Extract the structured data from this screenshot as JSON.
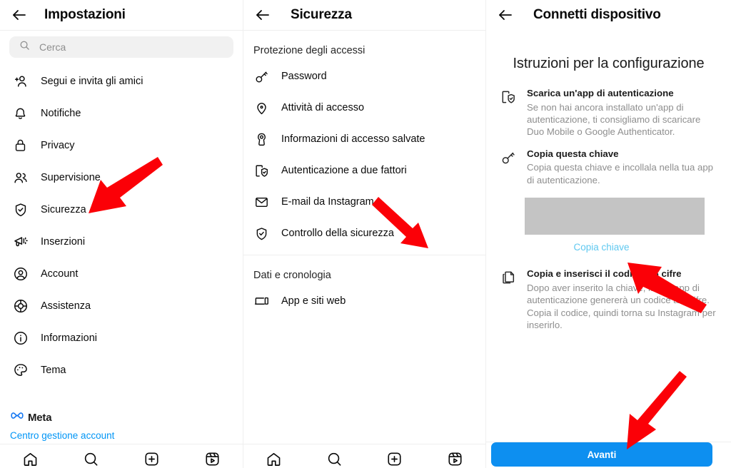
{
  "colors": {
    "accent_blue": "#0d8ff0",
    "link_blue": "#0095f6",
    "copy_link_blue": "#5fc8f0",
    "arrow_red": "#fb0007",
    "text_primary": "#0a0a0a",
    "text_secondary": "#8e8e8e",
    "search_bg": "#f1f1f1",
    "key_box_gray": "#c4c4c4",
    "divider": "#efefef"
  },
  "panel_settings": {
    "header": {
      "title": "Impostazioni",
      "back_icon": "back-arrow-icon"
    },
    "search": {
      "placeholder": "Cerca",
      "icon": "search-icon"
    },
    "items": [
      {
        "label": "Segui e invita gli amici",
        "icon": "add-person-icon"
      },
      {
        "label": "Notifiche",
        "icon": "bell-icon"
      },
      {
        "label": "Privacy",
        "icon": "lock-icon"
      },
      {
        "label": "Supervisione",
        "icon": "people-icon"
      },
      {
        "label": "Sicurezza",
        "icon": "shield-check-icon"
      },
      {
        "label": "Inserzioni",
        "icon": "megaphone-icon"
      },
      {
        "label": "Account",
        "icon": "account-circle-icon"
      },
      {
        "label": "Assistenza",
        "icon": "lifebuoy-icon"
      },
      {
        "label": "Informazioni",
        "icon": "info-circle-icon"
      },
      {
        "label": "Tema",
        "icon": "palette-icon"
      }
    ],
    "footer": {
      "meta_logo_icon": "meta-infinity-icon",
      "meta_label": "Meta",
      "account_center_link": "Centro gestione account"
    },
    "tabbar": [
      {
        "icon": "home-icon"
      },
      {
        "icon": "search-circle-icon"
      },
      {
        "icon": "add-square-icon"
      },
      {
        "icon": "reels-icon"
      }
    ]
  },
  "panel_security": {
    "header": {
      "title": "Sicurezza",
      "back_icon": "back-arrow-icon"
    },
    "sections": [
      {
        "title": "Protezione degli accessi",
        "items": [
          {
            "label": "Password",
            "icon": "key-icon"
          },
          {
            "label": "Attività di accesso",
            "icon": "location-pin-icon"
          },
          {
            "label": "Informazioni di accesso salvate",
            "icon": "keyhole-icon"
          },
          {
            "label": "Autenticazione a due fattori",
            "icon": "two-factor-shield-icon"
          },
          {
            "label": "E-mail da Instagram",
            "icon": "envelope-icon"
          },
          {
            "label": "Controllo della sicurezza",
            "icon": "shield-check-icon"
          }
        ]
      },
      {
        "title": "Dati e cronologia",
        "items": [
          {
            "label": "App e siti web",
            "icon": "devices-icon"
          }
        ]
      }
    ],
    "tabbar": [
      {
        "icon": "home-icon"
      },
      {
        "icon": "search-circle-icon"
      },
      {
        "icon": "add-square-icon"
      },
      {
        "icon": "reels-icon"
      }
    ]
  },
  "panel_connect_device": {
    "header": {
      "title": "Connetti dispositivo",
      "back_icon": "back-arrow-icon"
    },
    "heading": "Istruzioni per la configurazione",
    "instructions": [
      {
        "icon": "two-factor-shield-icon",
        "title": "Scarica un'app di autenticazione",
        "desc": "Se non hai ancora installato un'app di autenticazione, ti consigliamo di scaricare Duo Mobile o Google Authenticator."
      },
      {
        "icon": "key-icon",
        "title": "Copia questa chiave",
        "desc": "Copia questa chiave e incollala nella tua app di autenticazione."
      }
    ],
    "key_field": {
      "value": "",
      "name": "secret-key-box"
    },
    "copy_key_link": "Copia chiave",
    "instructions_2": [
      {
        "icon": "copy-icon",
        "title": "Copia e inserisci il codice a 6 cifre",
        "desc": "Dopo aver inserito la chiave, la tua app di autenticazione genererà un codice a 6 cifre. Copia il codice, quindi torna su Instagram per inserirlo."
      }
    ],
    "next_button": "Avanti"
  },
  "annotations": {
    "arrows": [
      {
        "name": "arrow-to-sicurezza",
        "target": "Sicurezza"
      },
      {
        "name": "arrow-to-autenticazione-due-fattori",
        "target": "Autenticazione a due fattori"
      },
      {
        "name": "arrow-to-copia-chiave",
        "target": "Copia chiave"
      },
      {
        "name": "arrow-to-avanti",
        "target": "Avanti"
      }
    ]
  }
}
